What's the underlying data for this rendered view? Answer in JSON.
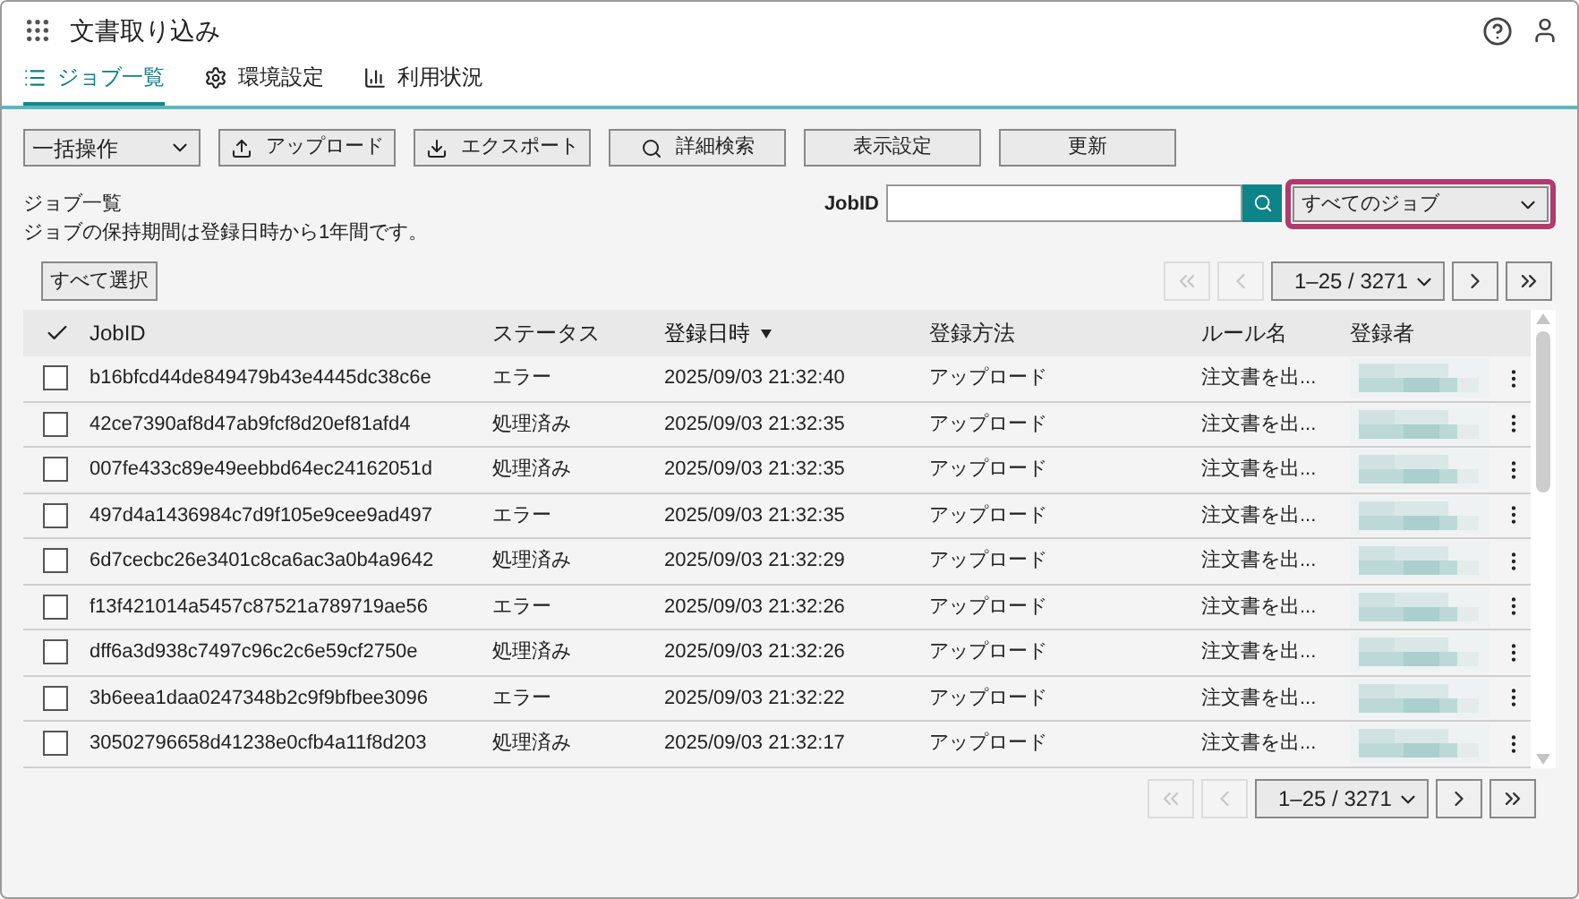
{
  "app": {
    "title": "文書取り込み"
  },
  "tabs": [
    {
      "label": "ジョブ一覧",
      "selected": true
    },
    {
      "label": "環境設定",
      "selected": false
    },
    {
      "label": "利用状況",
      "selected": false
    }
  ],
  "toolbar": {
    "bulk_action": "一括操作",
    "buttons": [
      "アップロード",
      "エクスポート",
      "詳細検索",
      "表示設定",
      "更新"
    ]
  },
  "heading": "ジョブ一覧",
  "note": "ジョブの保持期間は登録日時から1年間です。",
  "search": {
    "label": "JobID",
    "filter": "すべてのジョブ"
  },
  "select_all": "すべて選択",
  "pagination_top": {
    "range": "1–25 / 3271",
    "first_disabled": true,
    "prev_disabled": true,
    "next_disabled": false,
    "last_disabled": false
  },
  "pagination_bottom": {
    "range": "1–25 / 3271",
    "first_disabled": true,
    "prev_disabled": true,
    "next_disabled": false,
    "last_disabled": false
  },
  "table": {
    "columns": [
      {
        "label": "JobID",
        "sorted": false
      },
      {
        "label": "ステータス",
        "sorted": false
      },
      {
        "label": "登録日時",
        "sorted": true
      },
      {
        "label": "登録方法",
        "sorted": false
      },
      {
        "label": "ルール名",
        "sorted": false
      },
      {
        "label": "登録者",
        "sorted": false
      }
    ],
    "rows": [
      {
        "checked": false,
        "job_id": "b16bfcd44de849479b43e4445dc38c6e",
        "status": "エラー",
        "date": "2025/09/03 21:32:40",
        "method": "アップロード",
        "rule": "注文書を出..."
      },
      {
        "checked": false,
        "job_id": "42ce7390af8d47ab9fcf8d20ef81afd4",
        "status": "処理済み",
        "date": "2025/09/03 21:32:35",
        "method": "アップロード",
        "rule": "注文書を出..."
      },
      {
        "checked": false,
        "job_id": "007fe433c89e49eebbd64ec24162051d",
        "status": "処理済み",
        "date": "2025/09/03 21:32:35",
        "method": "アップロード",
        "rule": "注文書を出..."
      },
      {
        "checked": false,
        "job_id": "497d4a1436984c7d9f105e9cee9ad497",
        "status": "エラー",
        "date": "2025/09/03 21:32:35",
        "method": "アップロード",
        "rule": "注文書を出..."
      },
      {
        "checked": false,
        "job_id": "6d7cecbc26e3401c8ca6ac3a0b4a9642",
        "status": "処理済み",
        "date": "2025/09/03 21:32:29",
        "method": "アップロード",
        "rule": "注文書を出..."
      },
      {
        "checked": false,
        "job_id": "f13f421014a5457c87521a789719ae56",
        "status": "エラー",
        "date": "2025/09/03 21:32:26",
        "method": "アップロード",
        "rule": "注文書を出..."
      },
      {
        "checked": false,
        "job_id": "dff6a3d938c7497c96c2c6e59cf2750e",
        "status": "処理済み",
        "date": "2025/09/03 21:32:26",
        "method": "アップロード",
        "rule": "注文書を出..."
      },
      {
        "checked": false,
        "job_id": "3b6eea1daa0247348b2c9f9bfbee3096",
        "status": "エラー",
        "date": "2025/09/03 21:32:22",
        "method": "アップロード",
        "rule": "注文書を出..."
      },
      {
        "checked": false,
        "job_id": "30502796658d41238e0cfb4a11f8d203",
        "status": "処理済み",
        "date": "2025/09/03 21:32:17",
        "method": "アップロード",
        "rule": "注文書を出..."
      }
    ]
  }
}
